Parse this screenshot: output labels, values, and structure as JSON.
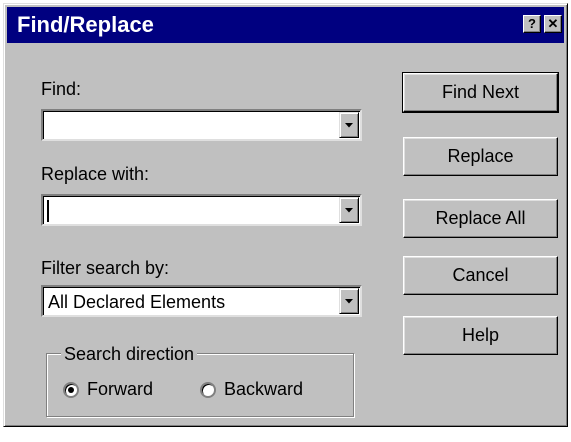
{
  "window": {
    "title": "Find/Replace",
    "help_glyph": "?",
    "close_glyph": "✕"
  },
  "find": {
    "label": "Find:",
    "value": ""
  },
  "replace": {
    "label": "Replace with:",
    "value": ""
  },
  "filter": {
    "label": "Filter search by:",
    "selected": "All Declared Elements"
  },
  "buttons": {
    "find_next": "Find Next",
    "replace": "Replace",
    "replace_all": "Replace All",
    "cancel": "Cancel",
    "help": "Help"
  },
  "direction": {
    "title": "Search direction",
    "forward": "Forward",
    "backward": "Backward",
    "selected": "Forward"
  }
}
